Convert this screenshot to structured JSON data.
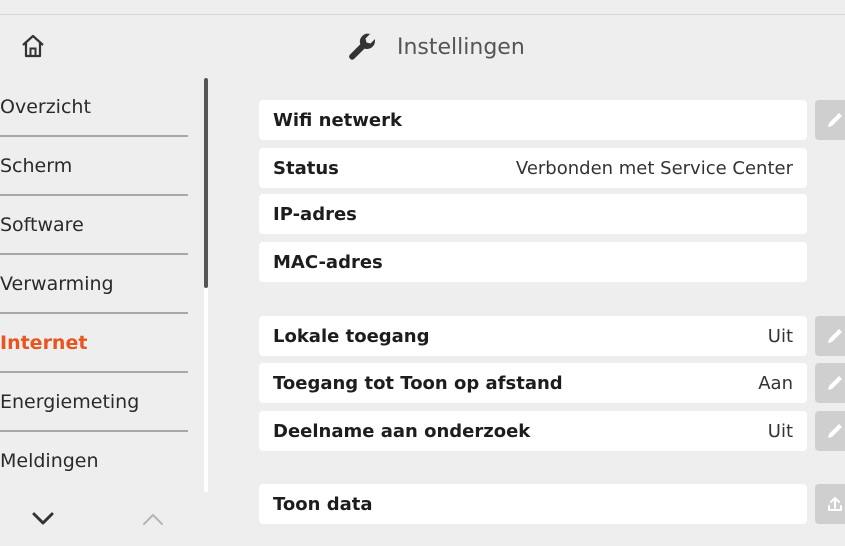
{
  "header": {
    "title": "Instellingen",
    "home_icon": "home-icon",
    "title_icon": "wrench-icon"
  },
  "sidebar": {
    "items": [
      {
        "label": "Overzicht",
        "active": false
      },
      {
        "label": "Scherm",
        "active": false
      },
      {
        "label": "Software",
        "active": false
      },
      {
        "label": "Verwarming",
        "active": false
      },
      {
        "label": "Internet",
        "active": true
      },
      {
        "label": "Energiemeting",
        "active": false
      },
      {
        "label": "Meldingen",
        "active": false
      }
    ],
    "scroll_down_icon": "chevron-down-icon",
    "scroll_up_icon": "chevron-up-icon"
  },
  "main": {
    "rows": [
      {
        "label": "Wifi netwerk",
        "value": "",
        "action_icon": "pencil-icon"
      },
      {
        "label": "Status",
        "value": "Verbonden met Service Center",
        "action_icon": ""
      },
      {
        "label": "IP-adres",
        "value": "",
        "action_icon": ""
      },
      {
        "label": "MAC-adres",
        "value": "",
        "action_icon": ""
      },
      {
        "label": "Lokale toegang",
        "value": "Uit",
        "action_icon": "pencil-icon"
      },
      {
        "label": "Toegang tot Toon op afstand",
        "value": "Aan",
        "action_icon": "pencil-icon"
      },
      {
        "label": "Deelname aan onderzoek",
        "value": "Uit",
        "action_icon": "pencil-icon"
      },
      {
        "label": "Toon data",
        "value": "",
        "action_icon": "upload-icon"
      }
    ]
  },
  "colors": {
    "accent": "#e9551f",
    "background": "#eeeeee",
    "row_background": "#ffffff",
    "button_background": "#cfcfcf"
  }
}
